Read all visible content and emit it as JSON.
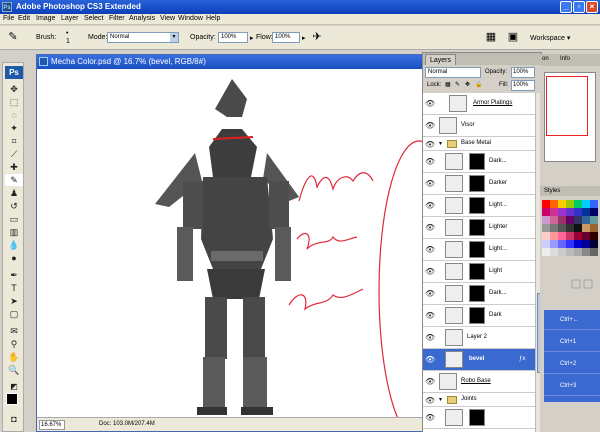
{
  "titlebar": {
    "title": "Adobe Photoshop CS3 Extended",
    "app_icon": "ps-icon"
  },
  "menu": [
    "File",
    "Edit",
    "Image",
    "Layer",
    "Select",
    "Filter",
    "Analysis",
    "View",
    "Window",
    "Help"
  ],
  "options": {
    "brush_label": "Brush:",
    "brush_size": "1",
    "mode_label": "Mode:",
    "mode_value": "Normal",
    "opacity_label": "Opacity:",
    "opacity_value": "100%",
    "flow_label": "Flow:",
    "flow_value": "100%",
    "workspace_label": "Workspace ▾"
  },
  "tools": {
    "badge": "Ps"
  },
  "document": {
    "title": "Mecha Color.psd @ 16.7% (bevel, RGB/8#)",
    "zoom": "16.67%",
    "doc_info": "Doc: 103.0M/207.4M",
    "annotation_color": "#e0283a"
  },
  "layers_panel": {
    "tab": "Layers",
    "blend_mode": "Normal",
    "opacity_label": "Opacity:",
    "opacity_value": "100%",
    "lock_label": "Lock:",
    "fill_label": "Fill:",
    "fill_value": "100%",
    "layers": [
      {
        "name": "Armor Platings",
        "type": "layer"
      },
      {
        "name": "Visor",
        "type": "layer"
      },
      {
        "name": "Base Metal",
        "type": "group"
      },
      {
        "name": "Dark...",
        "type": "masked"
      },
      {
        "name": "Darker",
        "type": "masked"
      },
      {
        "name": "Light...",
        "type": "masked"
      },
      {
        "name": "Lighter",
        "type": "masked"
      },
      {
        "name": "Light...",
        "type": "masked"
      },
      {
        "name": "Light",
        "type": "masked"
      },
      {
        "name": "Dark...",
        "type": "masked"
      },
      {
        "name": "Dark",
        "type": "masked"
      },
      {
        "name": "Layer 2",
        "type": "layer"
      },
      {
        "name": "bevel",
        "type": "layer",
        "selected": true
      },
      {
        "name": "Robo Base",
        "type": "layer"
      },
      {
        "name": "Joints",
        "type": "group"
      }
    ]
  },
  "right_mini": {
    "tab_labels": [
      "on",
      "Info"
    ],
    "styles_tab": "Styles",
    "actions": [
      "Ctrl+←",
      "Ctrl+1",
      "Ctrl+2",
      "Ctrl+3"
    ]
  }
}
